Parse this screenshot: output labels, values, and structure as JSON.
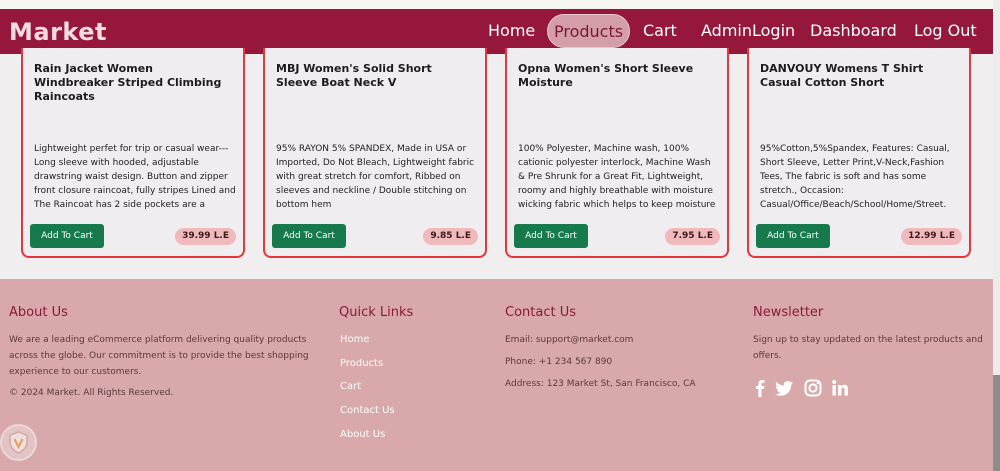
{
  "nav": {
    "brand": "Market",
    "links": [
      "Home",
      "Products",
      "Cart",
      "AdminLogin",
      "Dashboard",
      "Log Out"
    ],
    "active": "Products"
  },
  "products": [
    {
      "title": "Rain Jacket Women Windbreaker Striped Climbing Raincoats",
      "description": "Lightweight perfet for trip or casual wear---Long sleeve with hooded, adjustable drawstring waist design. Button and zipper front closure raincoat, fully stripes Lined and The Raincoat has 2 side pockets are a",
      "button": "Add To Cart",
      "price": "39.99 L.E"
    },
    {
      "title": "MBJ Women's Solid Short Sleeve Boat Neck V",
      "description": "95% RAYON 5% SPANDEX, Made in USA or Imported, Do Not Bleach, Lightweight fabric with great stretch for comfort, Ribbed on sleeves and neckline / Double stitching on bottom hem",
      "button": "Add To Cart",
      "price": "9.85 L.E"
    },
    {
      "title": "Opna Women's Short Sleeve Moisture",
      "description": "100% Polyester, Machine wash, 100% cationic polyester interlock, Machine Wash & Pre Shrunk for a Great Fit, Lightweight, roomy and highly breathable with moisture wicking fabric which helps to keep moisture away,",
      "button": "Add To Cart",
      "price": "7.95 L.E"
    },
    {
      "title": "DANVOUY Womens T Shirt Casual Cotton Short",
      "description": "95%Cotton,5%Spandex, Features: Casual, Short Sleeve, Letter Print,V-Neck,Fashion Tees, The fabric is soft and has some stretch., Occasion: Casual/Office/Beach/School/Home/Street.",
      "button": "Add To Cart",
      "price": "12.99 L.E"
    }
  ],
  "footer": {
    "about": {
      "heading": "About Us",
      "text": "We are a leading eCommerce platform delivering quality products across the globe. Our commitment is to provide the best shopping experience to our customers.",
      "copyright": "© 2024 Market. All Rights Reserved."
    },
    "links": {
      "heading": "Quick Links",
      "items": [
        "Home",
        "Products",
        "Cart",
        "Contact Us",
        "About Us"
      ]
    },
    "contact": {
      "heading": "Contact Us",
      "email": "Email: support@market.com",
      "phone": "Phone: +1 234 567 890",
      "address": "Address: 123 Market St, San Francisco, CA"
    },
    "newsletter": {
      "heading": "Newsletter",
      "text": "Sign up to stay updated on the latest products and offers.",
      "icons": [
        "facebook-icon",
        "twitter-icon",
        "instagram-icon",
        "linkedin-icon"
      ]
    }
  },
  "colors": {
    "navbar": "#95183c",
    "footer": "#d8a8aa",
    "button": "#177a4c",
    "card_border": "#e8343c"
  }
}
